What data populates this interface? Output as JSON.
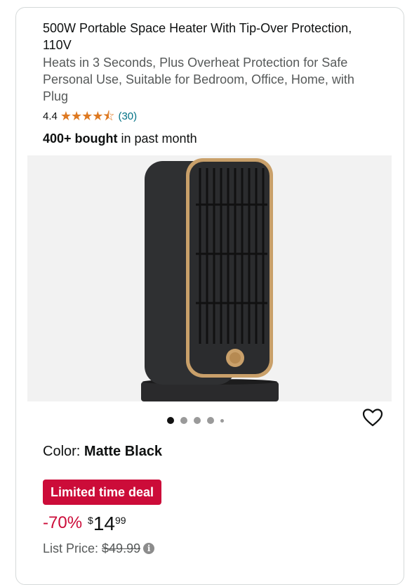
{
  "product": {
    "title": "500W Portable Space Heater With Tip-Over Protection, 110V",
    "subtitle": "Heats in 3 Seconds, Plus Overheat Protection for Safe Personal Use, Suitable for Bedroom, Office, Home, with Plug",
    "rating": "4.4",
    "rating_stars": 4.5,
    "rating_count": "(30)",
    "bought_bold": "400+ bought",
    "bought_rest": " in past month",
    "image_alt_icon": "space-heater-image",
    "carousel": {
      "total_dots": 5,
      "active_index": 0
    },
    "color_label": "Color: ",
    "color_value": "Matte Black",
    "deal_label": "Limited time deal",
    "discount": "-70%",
    "price_symbol": "$",
    "price_whole": "14",
    "price_fraction": "99",
    "list_price_label": "List Price:",
    "list_price_value": "$49.99",
    "info_glyph": "i"
  },
  "colors": {
    "deal_red": "#cc0c39",
    "star_orange": "#de7921",
    "link_teal": "#007185",
    "heater_body": "#2f3032",
    "heater_trim": "#c9a06a"
  },
  "icons": {
    "star": "star-icon",
    "heart": "heart-icon",
    "info": "info-icon"
  }
}
